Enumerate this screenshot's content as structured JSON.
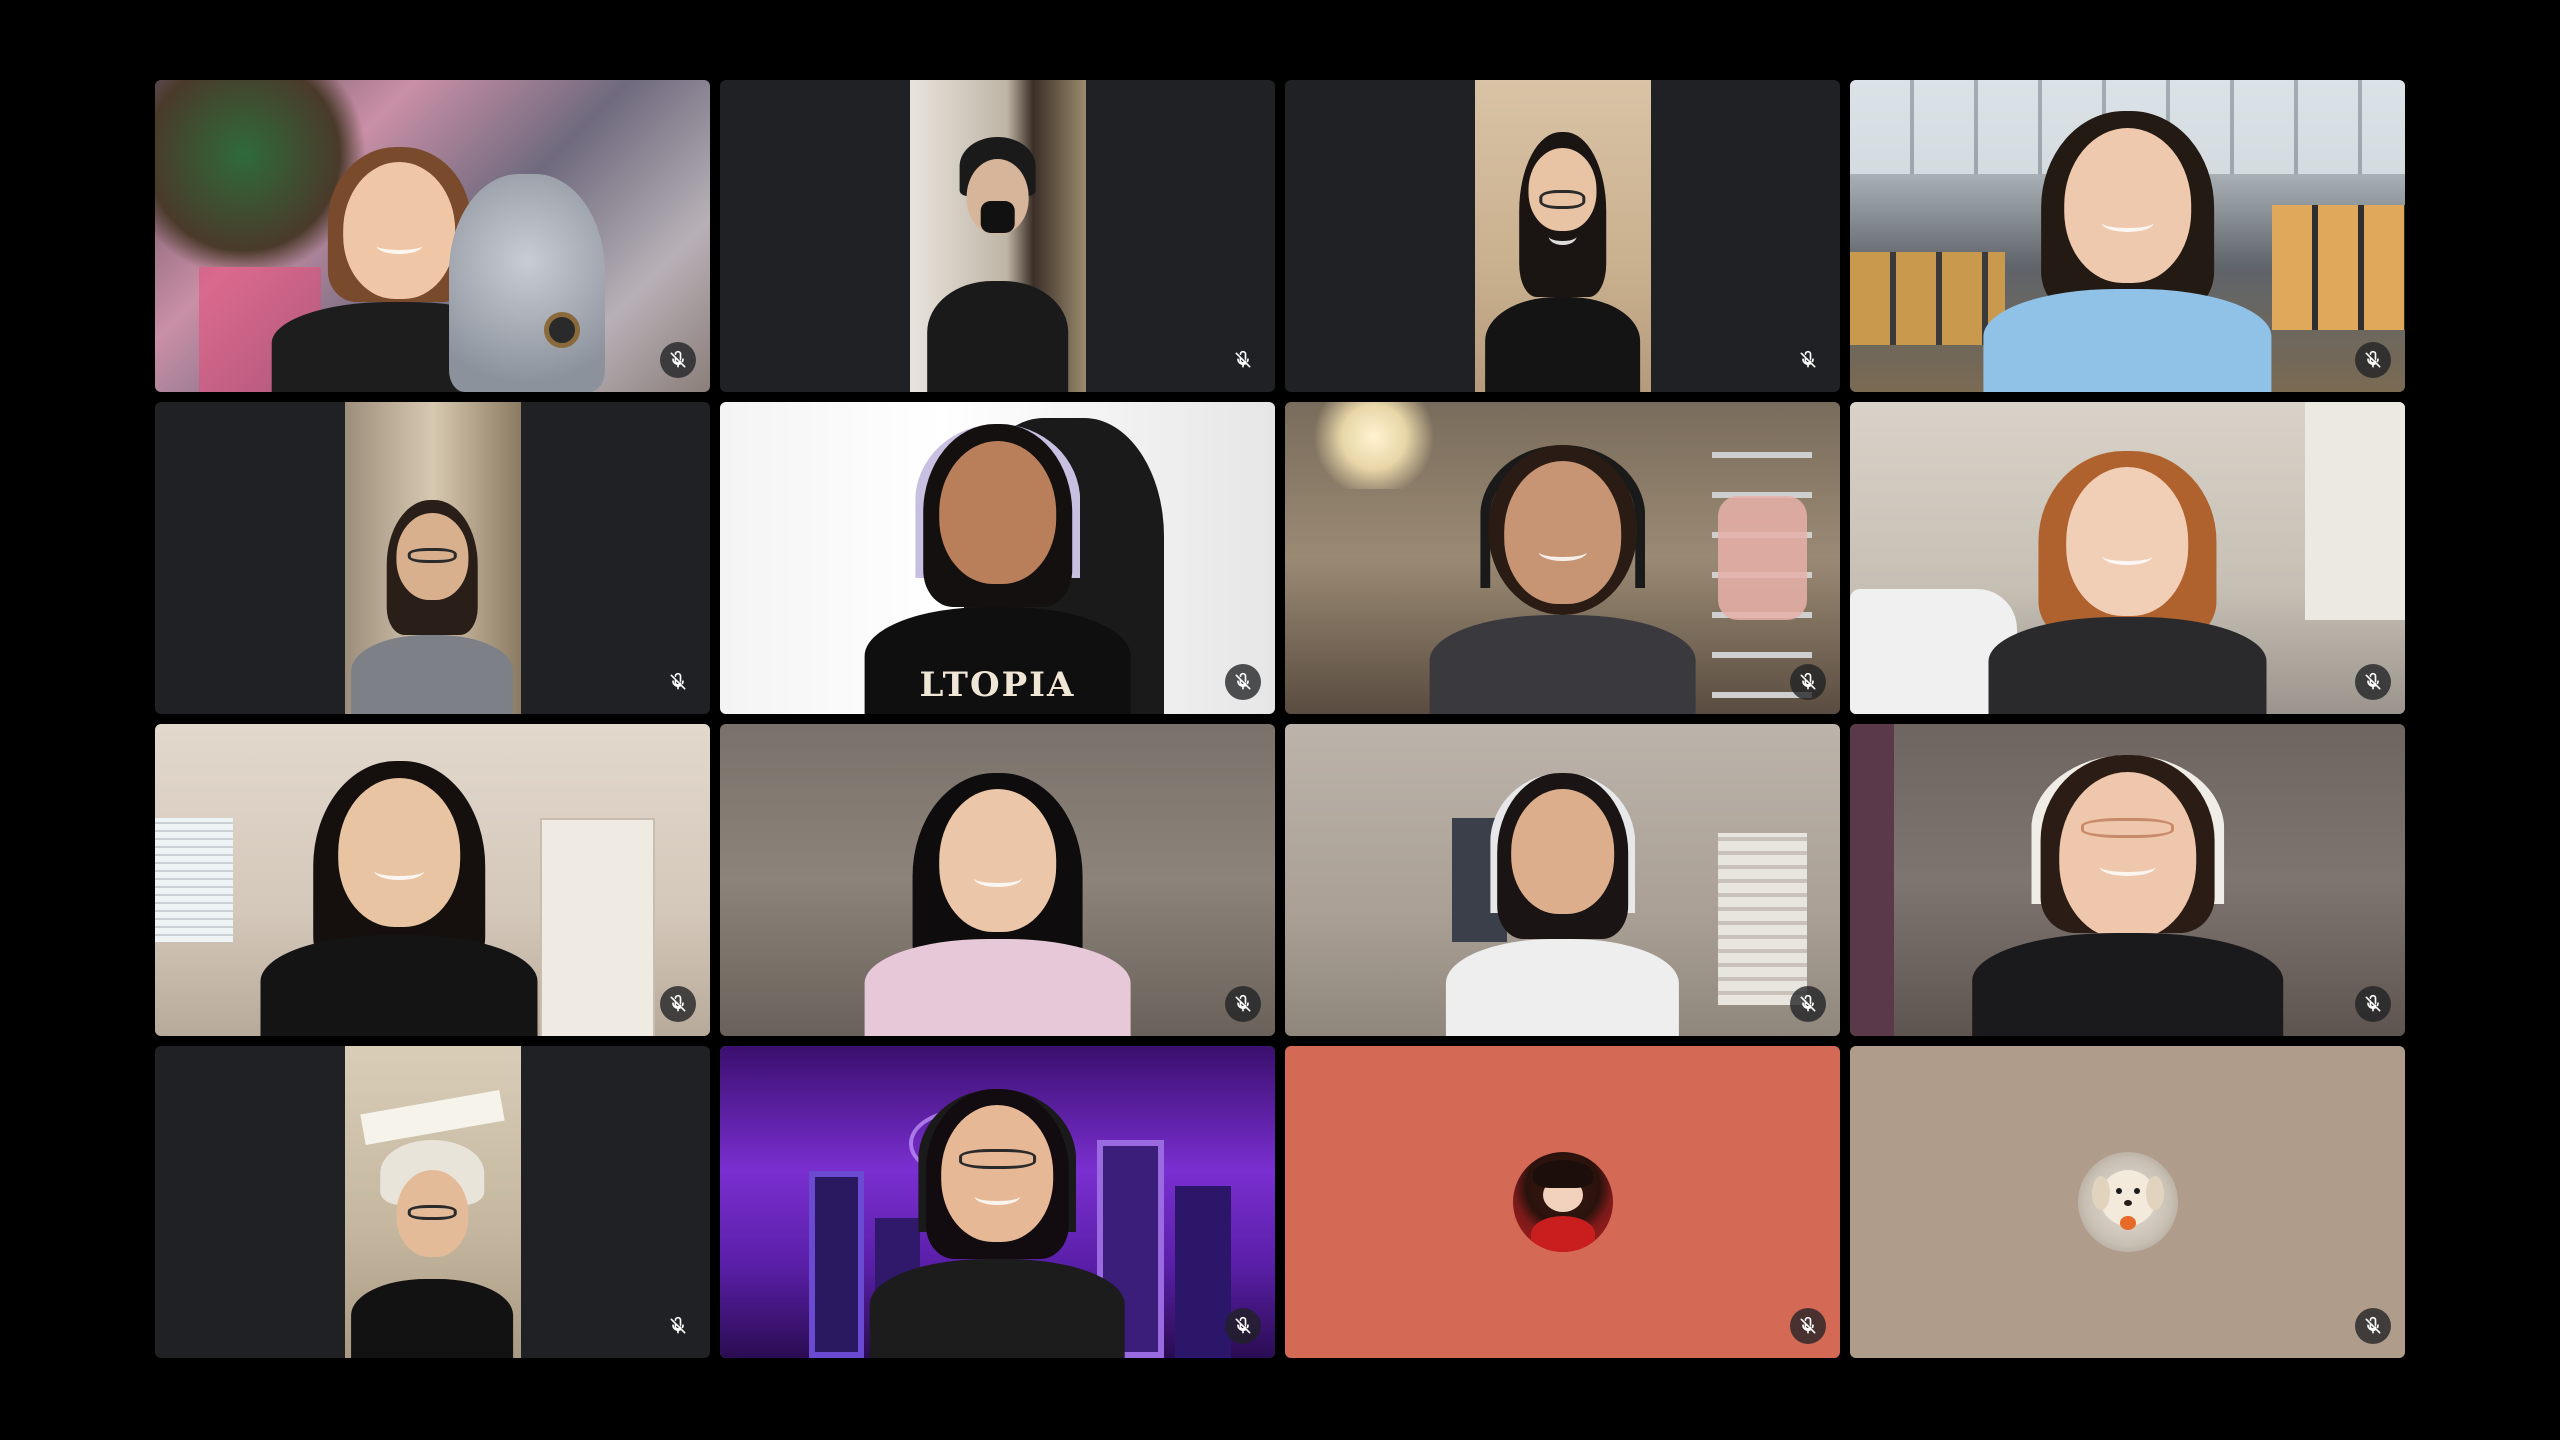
{
  "app": {
    "background_color": "#000000",
    "tile_color": "#202124",
    "speaking_border_color": "#34a853"
  },
  "tiles": [
    {
      "row": 1,
      "col": 1,
      "type": "video",
      "mic": "muted",
      "mic_icon": "mic-off-icon"
    },
    {
      "row": 1,
      "col": 2,
      "type": "video",
      "mic": "muted",
      "mic_icon": "mic-off-icon"
    },
    {
      "row": 1,
      "col": 3,
      "type": "video",
      "mic": "muted",
      "mic_icon": "mic-off-icon"
    },
    {
      "row": 1,
      "col": 4,
      "type": "video",
      "mic": "muted",
      "mic_icon": "mic-off-icon"
    },
    {
      "row": 2,
      "col": 1,
      "type": "video",
      "mic": "muted",
      "mic_icon": "mic-off-icon"
    },
    {
      "row": 2,
      "col": 2,
      "type": "video",
      "mic": "muted",
      "mic_icon": "mic-off-icon",
      "shirt_text": "LTOPIA"
    },
    {
      "row": 2,
      "col": 3,
      "type": "video",
      "mic": "muted",
      "mic_icon": "mic-off-icon"
    },
    {
      "row": 2,
      "col": 4,
      "type": "video",
      "mic": "muted",
      "mic_icon": "mic-off-icon"
    },
    {
      "row": 3,
      "col": 1,
      "type": "video",
      "mic": "muted",
      "mic_icon": "mic-off-icon"
    },
    {
      "row": 3,
      "col": 2,
      "type": "video",
      "mic": "muted",
      "mic_icon": "mic-off-icon"
    },
    {
      "row": 3,
      "col": 3,
      "type": "video",
      "mic": "muted",
      "mic_icon": "mic-off-icon"
    },
    {
      "row": 3,
      "col": 4,
      "type": "video",
      "mic": "muted",
      "mic_icon": "mic-off-icon"
    },
    {
      "row": 4,
      "col": 1,
      "type": "video",
      "mic": "muted",
      "mic_icon": "mic-off-icon"
    },
    {
      "row": 4,
      "col": 2,
      "type": "video",
      "mic": "muted",
      "mic_icon": "mic-off-icon",
      "speaking": true
    },
    {
      "row": 4,
      "col": 3,
      "type": "avatar",
      "mic": "muted",
      "mic_icon": "mic-off-icon",
      "tile_color": "#d46a56"
    },
    {
      "row": 4,
      "col": 4,
      "type": "avatar",
      "mic": "muted",
      "mic_icon": "mic-off-icon",
      "tile_color": "#b09c8b"
    }
  ]
}
